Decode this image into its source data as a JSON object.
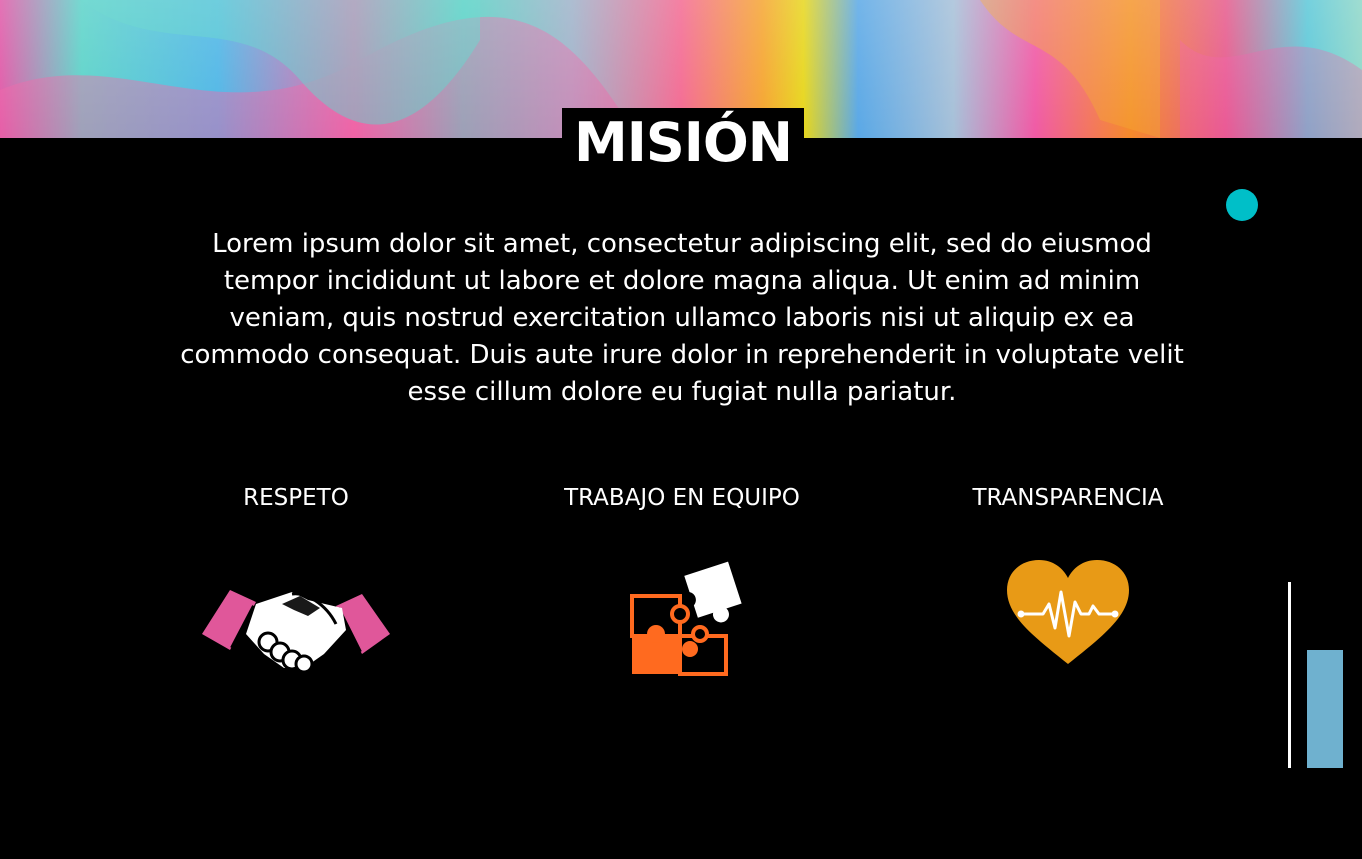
{
  "title": "MISIÓN",
  "body": "Lorem ipsum dolor sit amet, consectetur adipiscing elit, sed do eiusmod tempor incididunt ut labore et dolore magna aliqua. Ut enim ad minim veniam, quis nostrud exercitation ullamco laboris nisi ut aliquip ex ea commodo consequat. Duis aute irure dolor in reprehenderit in voluptate velit esse cillum dolore eu fugiat nulla pariatur.",
  "values": [
    {
      "label": "RESPETO",
      "icon": "handshake-icon",
      "color": "#e0579a"
    },
    {
      "label": "TRABAJO EN EQUIPO",
      "icon": "puzzle-icon",
      "color": "#ff6a1f"
    },
    {
      "label": "TRANSPARENCIA",
      "icon": "heartbeat-icon",
      "color": "#e89a16"
    }
  ],
  "colors": {
    "background": "#000000",
    "text": "#ffffff",
    "accent_dot": "#00bfc8",
    "accent_bar": "#6fb1cf"
  }
}
